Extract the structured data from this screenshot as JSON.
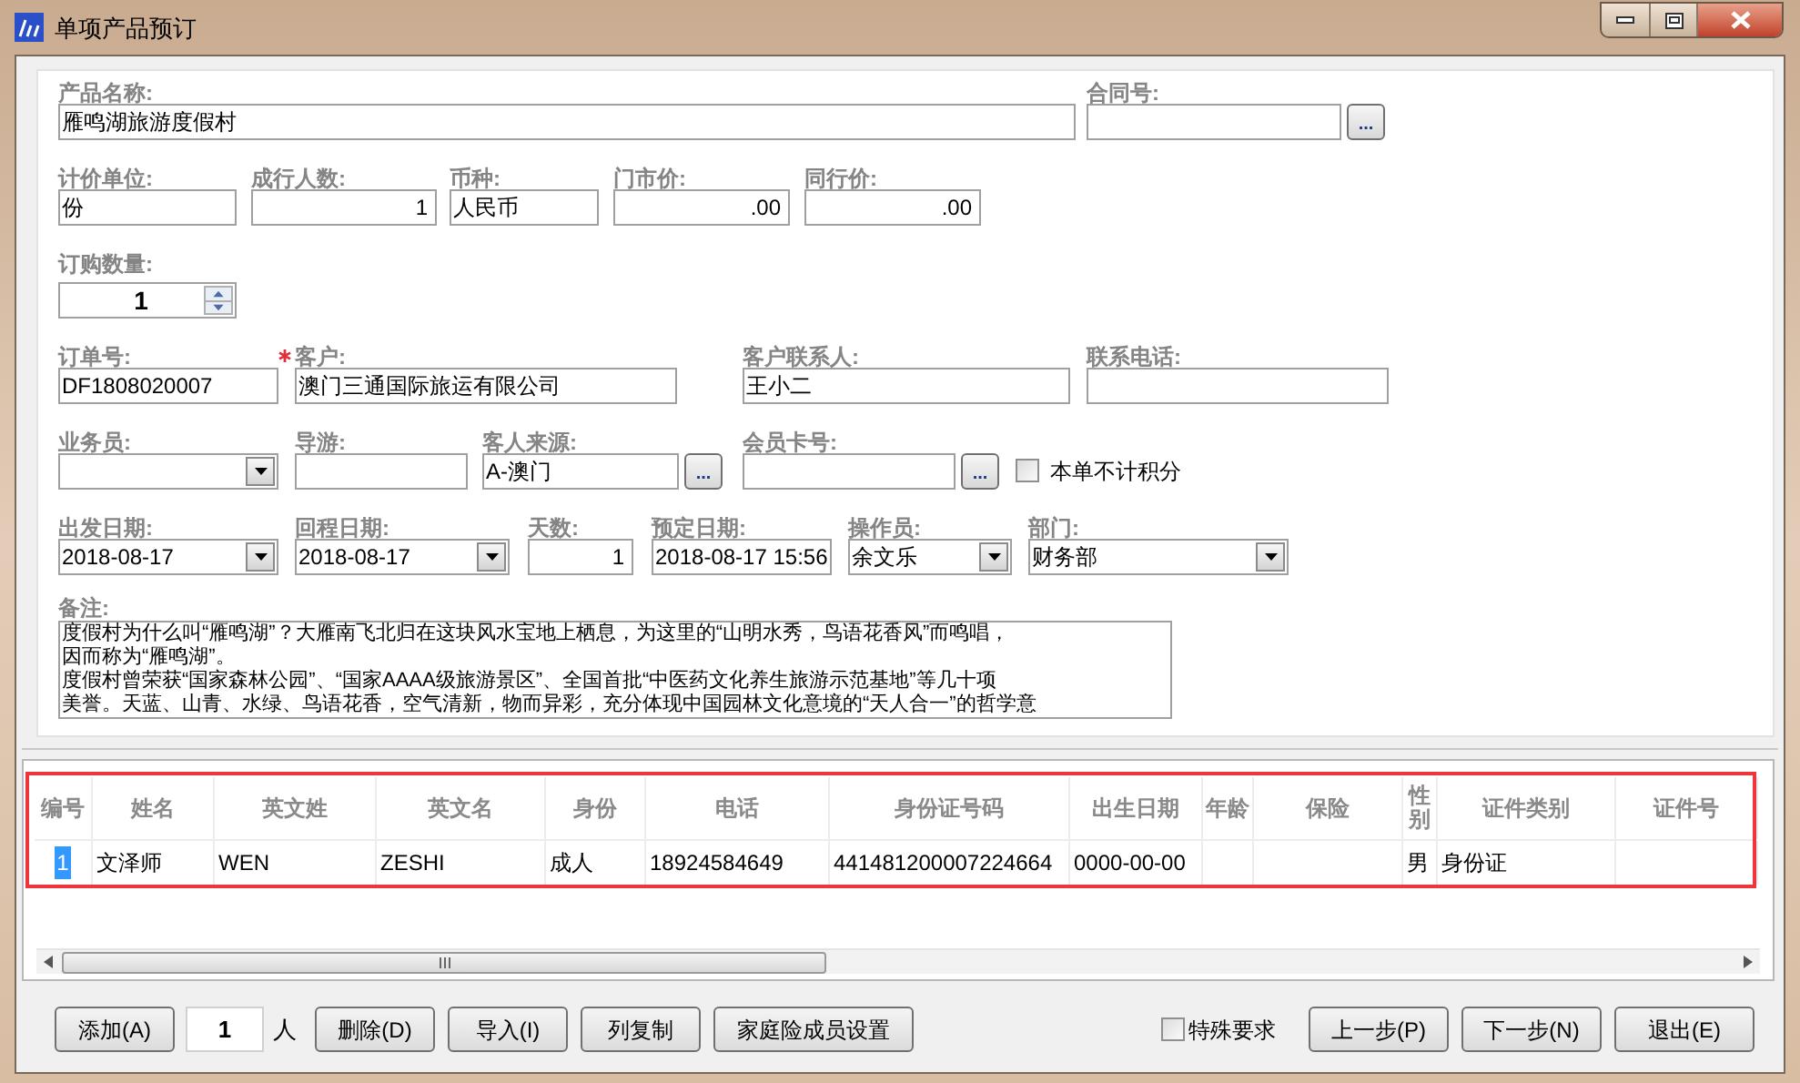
{
  "window": {
    "title": "单项产品预订"
  },
  "form": {
    "fields": [
      {
        "kind": "text",
        "label": "产品名称:",
        "value": "雁鸣湖旅游度假村"
      },
      {
        "kind": "lookup",
        "label": "合同号:",
        "button": "..."
      },
      {
        "kind": "text",
        "label": "计价单位:",
        "value": "份"
      },
      {
        "kind": "number",
        "label": "成行人数:",
        "value": "1"
      },
      {
        "kind": "text",
        "label": "币种:",
        "value": "人民币"
      },
      {
        "kind": "number",
        "label": "门市价:",
        "value": ".00"
      },
      {
        "kind": "number",
        "label": "同行价:",
        "value": ".00"
      },
      {
        "kind": "spinner",
        "label": "订购数量:",
        "value": "1"
      },
      {
        "kind": "text",
        "label": "订单号:",
        "value": "DF1808020007"
      },
      {
        "kind": "text",
        "label": "客户:",
        "value": "澳门三通国际旅运有限公司",
        "required": true
      },
      {
        "kind": "text",
        "label": "客户联系人:",
        "value": "王小二"
      },
      {
        "kind": "text",
        "label": "联系电话:"
      },
      {
        "kind": "dropdown",
        "label": "业务员:"
      },
      {
        "kind": "text",
        "label": "导游:"
      },
      {
        "kind": "lookup",
        "label": "客人来源:",
        "value": "A-澳门",
        "button": "..."
      },
      {
        "kind": "lookup",
        "label": "会员卡号:",
        "button": "..."
      },
      {
        "kind": "checkbox",
        "label": "本单不计积分",
        "checked": false
      },
      {
        "kind": "dropdown",
        "label": "出发日期:",
        "value": "2018-08-17"
      },
      {
        "kind": "dropdown",
        "label": "回程日期:",
        "value": "2018-08-17"
      },
      {
        "kind": "number",
        "label": "天数:",
        "value": "1"
      },
      {
        "kind": "text",
        "label": "预定日期:",
        "value": "2018-08-17 15:56"
      },
      {
        "kind": "dropdown",
        "label": "操作员:",
        "value": "余文乐"
      },
      {
        "kind": "dropdown",
        "label": "部门:",
        "value": "财务部"
      }
    ],
    "notes": {
      "label": "备注:",
      "lines": [
        "度假村为什么叫“雁鸣湖”？大雁南飞北归在这块风水宝地上栖息，为这里的“山明水秀，鸟语花香风”而鸣唱，",
        "因而称为“雁鸣湖”。",
        "度假村曾荣获“国家森林公园”、“国家AAAA级旅游景区”、全国首批“中医药文化养生旅游示范基地”等几十项",
        "美誉。天蓝、山青、水绿、鸟语花香，空气清新，物而异彩，充分体现中国园林文化意境的“天人合一”的哲学意"
      ]
    }
  },
  "table": {
    "columns": [
      "编号",
      "姓名",
      "英文姓",
      "英文名",
      "身份",
      "电话",
      "身份证号码",
      "出生日期",
      "年龄",
      "保险",
      "性别",
      "证件类别",
      "证件号"
    ],
    "rows": [
      {
        "selected": true,
        "cells": [
          "1",
          "文泽师",
          "WEN",
          "ZESHI",
          "成人",
          "18924584649",
          "441481200007224664",
          "0000-00-00",
          null,
          null,
          "男",
          "身份证",
          null
        ]
      }
    ]
  },
  "footer": {
    "add_button": "添加(A)",
    "count": "1",
    "count_unit": "人",
    "buttons": [
      "删除(D)",
      "导入(I)",
      "列复制",
      "家庭险成员设置"
    ],
    "special_checkbox": {
      "label": "特殊要求",
      "checked": false
    },
    "nav_buttons": [
      "上一步(P)",
      "下一步(N)",
      "退出(E)"
    ]
  }
}
